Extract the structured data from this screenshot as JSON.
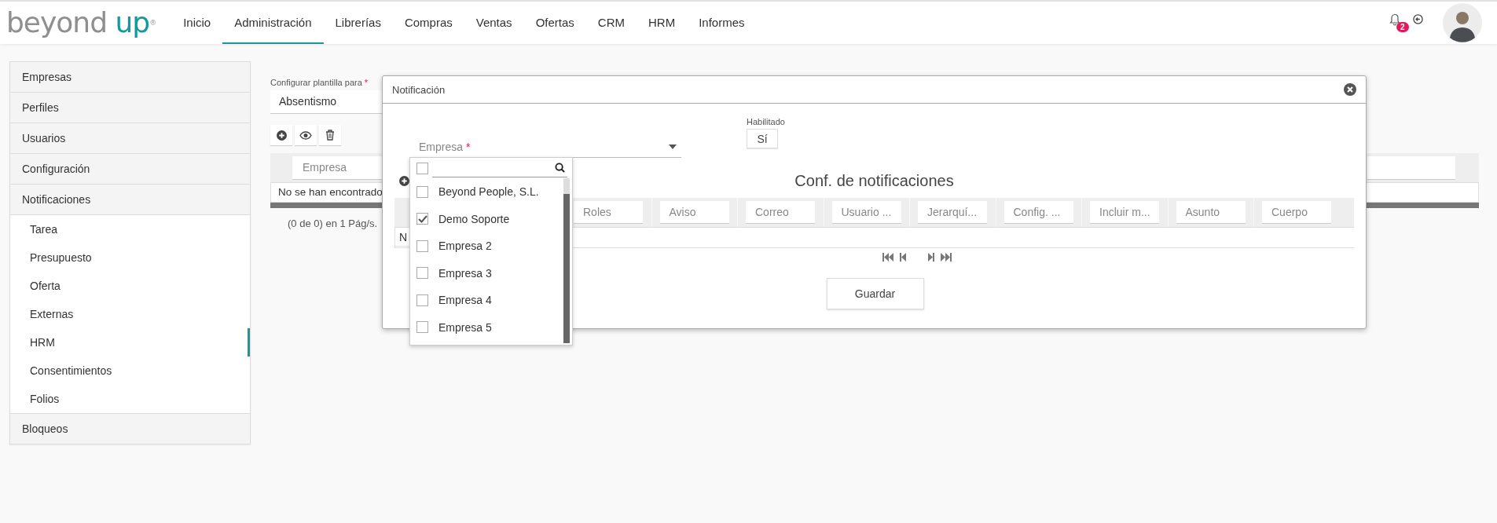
{
  "logo": {
    "word": "beyond",
    "accent": "up",
    "mark": "®"
  },
  "nav": [
    {
      "label": "Inicio",
      "selected": false
    },
    {
      "label": "Administración",
      "selected": true
    },
    {
      "label": "Librerías",
      "selected": false
    },
    {
      "label": "Compras",
      "selected": false
    },
    {
      "label": "Ventas",
      "selected": false
    },
    {
      "label": "Ofertas",
      "selected": false
    },
    {
      "label": "CRM",
      "selected": false
    },
    {
      "label": "HRM",
      "selected": false
    },
    {
      "label": "Informes",
      "selected": false
    }
  ],
  "notifications": {
    "badge": "2"
  },
  "sidebar": {
    "items": [
      {
        "label": "Empresas"
      },
      {
        "label": "Perfiles"
      },
      {
        "label": "Usuarios"
      },
      {
        "label": "Configuración"
      },
      {
        "label": "Notificaciones",
        "children": [
          {
            "label": "Tarea",
            "selected": false
          },
          {
            "label": "Presupuesto",
            "selected": false
          },
          {
            "label": "Oferta",
            "selected": false
          },
          {
            "label": "Externas",
            "selected": false
          },
          {
            "label": "HRM",
            "selected": true
          },
          {
            "label": "Consentimientos",
            "selected": false
          },
          {
            "label": "Folios",
            "selected": false
          }
        ]
      },
      {
        "label": "Bloqueos"
      }
    ]
  },
  "template": {
    "label": "Configurar plantilla para",
    "required_mark": "*",
    "value": "Absentismo"
  },
  "table": {
    "filter_placeholder": "Empresa",
    "empty_text": "No se han encontrado",
    "pager": "(0 de 0) en 1 Pág/s."
  },
  "dialog": {
    "title": "Notificación",
    "company_field": {
      "placeholder": "Empresa",
      "required_mark": "*"
    },
    "enabled": {
      "label": "Habilitado",
      "value": "Sí"
    },
    "section_title": "Conf. de notificaciones",
    "columns": [
      "Roles",
      "Aviso",
      "Correo",
      "Usuario ...",
      "Jerarquí...",
      "Config. ...",
      "Incluir m...",
      "Asunto",
      "Cuerpo"
    ],
    "empty_text": "N",
    "save": "Guardar"
  },
  "dropdown": {
    "select_all_checked": false,
    "options": [
      {
        "label": "Beyond People, S.L.",
        "checked": false
      },
      {
        "label": "Demo Soporte",
        "checked": true
      },
      {
        "label": "Empresa 2",
        "checked": false
      },
      {
        "label": "Empresa 3",
        "checked": false
      },
      {
        "label": "Empresa 4",
        "checked": false
      },
      {
        "label": "Empresa 5",
        "checked": false
      }
    ]
  }
}
